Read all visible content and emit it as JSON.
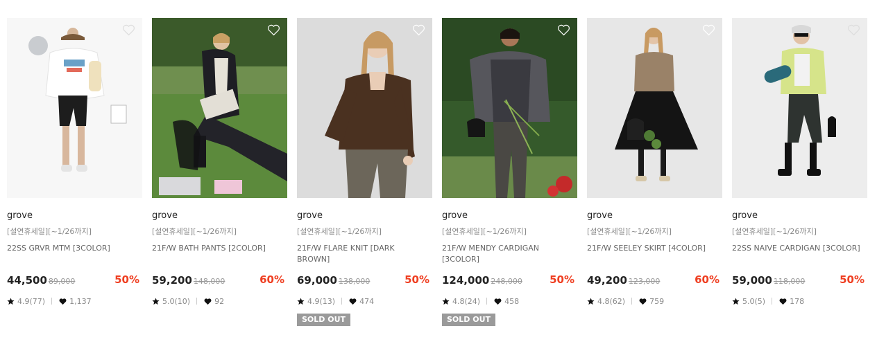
{
  "colors": {
    "accent_discount": "#ef3f22",
    "soldout_bg": "#9a9a9a"
  },
  "icons": {
    "wishlist": "heart-outline-icon",
    "rating": "star-icon",
    "likes": "heart-filled-icon"
  },
  "products": [
    {
      "brand": "grove",
      "promo": "[설연휴세일][~1/26까지]",
      "name": "22SS GRVR MTM [3COLOR]",
      "price": "44,500",
      "original_price": "89,000",
      "discount": "50%",
      "rating": "4.9(77)",
      "likes": "1,137",
      "sold_out": ""
    },
    {
      "brand": "grove",
      "promo": "[설연휴세일][~1/26까지]",
      "name": "21F/W BATH PANTS [2COLOR]",
      "price": "59,200",
      "original_price": "148,000",
      "discount": "60%",
      "rating": "5.0(10)",
      "likes": "92",
      "sold_out": ""
    },
    {
      "brand": "grove",
      "promo": "[설연휴세일][~1/26까지]",
      "name": "21F/W FLARE KNIT [DARK BROWN]",
      "price": "69,000",
      "original_price": "138,000",
      "discount": "50%",
      "rating": "4.9(13)",
      "likes": "474",
      "sold_out": "SOLD OUT"
    },
    {
      "brand": "grove",
      "promo": "[설연휴세일][~1/26까지]",
      "name": "21F/W MENDY CARDIGAN [3COLOR]",
      "price": "124,000",
      "original_price": "248,000",
      "discount": "50%",
      "rating": "4.8(24)",
      "likes": "458",
      "sold_out": "SOLD OUT"
    },
    {
      "brand": "grove",
      "promo": "[설연휴세일][~1/26까지]",
      "name": "21F/W SEELEY SKIRT [4COLOR]",
      "price": "49,200",
      "original_price": "123,000",
      "discount": "60%",
      "rating": "4.8(62)",
      "likes": "759",
      "sold_out": ""
    },
    {
      "brand": "grove",
      "promo": "[설연휴세일][~1/26까지]",
      "name": "22SS NAIVE CARDIGAN [3COLOR]",
      "price": "59,000",
      "original_price": "118,000",
      "discount": "50%",
      "rating": "5.0(5)",
      "likes": "178",
      "sold_out": ""
    }
  ]
}
